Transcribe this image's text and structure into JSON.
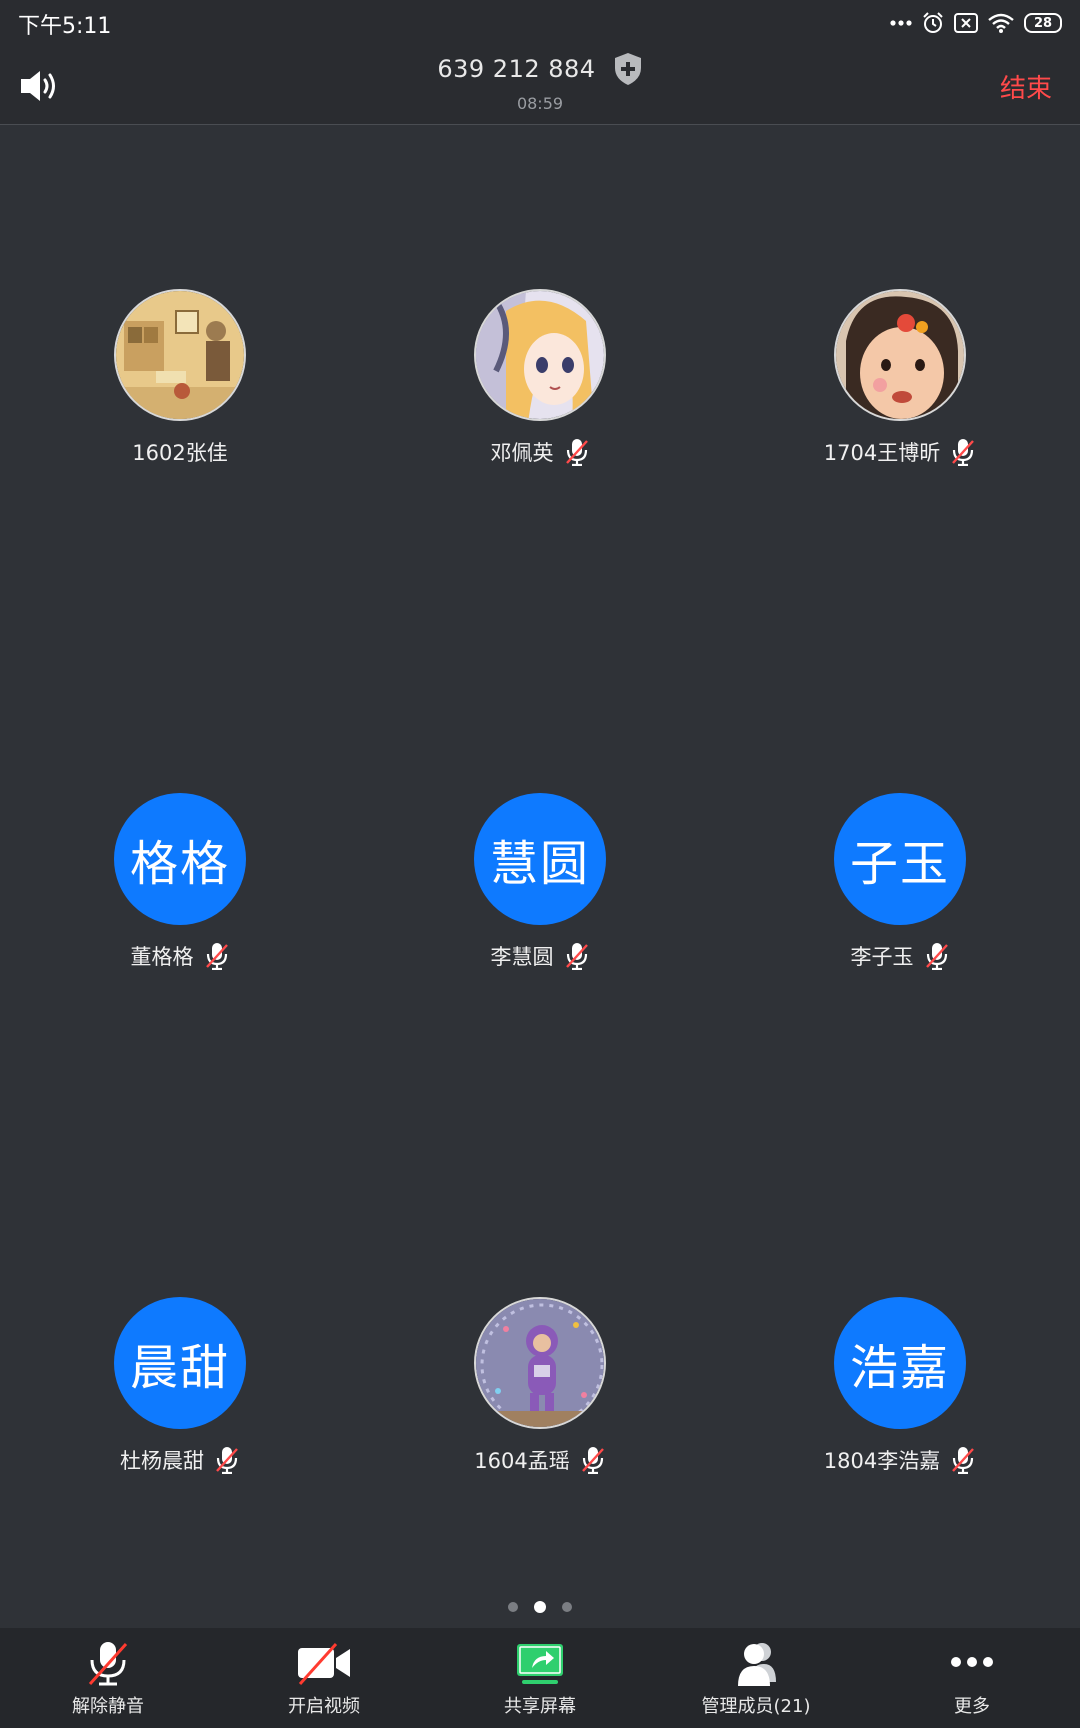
{
  "status_bar": {
    "time": "下午5:11",
    "battery": "28",
    "icons": [
      "more-dots-icon",
      "alarm-icon",
      "notification-x-icon",
      "wifi-icon",
      "battery-icon"
    ]
  },
  "header": {
    "meeting_id": "639 212 884",
    "duration": "08:59",
    "end_label": "结束",
    "end_color": "#ff4a4a",
    "speaker_icon": "speaker-icon",
    "shield_icon": "shield-icon"
  },
  "participants": [
    {
      "name": "1602张佳",
      "avatar_type": "photo",
      "avatar_text": "",
      "muted": false
    },
    {
      "name": "邓佩英",
      "avatar_type": "photo",
      "avatar_text": "",
      "muted": true
    },
    {
      "name": "1704王博昕",
      "avatar_type": "photo",
      "avatar_text": "",
      "muted": true
    },
    {
      "name": "董格格",
      "avatar_type": "text",
      "avatar_text": "格格",
      "muted": true
    },
    {
      "name": "李慧圆",
      "avatar_type": "text",
      "avatar_text": "慧圆",
      "muted": true
    },
    {
      "name": "李子玉",
      "avatar_type": "text",
      "avatar_text": "子玉",
      "muted": true
    },
    {
      "name": "杜杨晨甜",
      "avatar_type": "text",
      "avatar_text": "晨甜",
      "muted": true
    },
    {
      "name": "1604孟瑶",
      "avatar_type": "photo",
      "avatar_text": "",
      "muted": true
    },
    {
      "name": "1804李浩嘉",
      "avatar_type": "text",
      "avatar_text": "浩嘉",
      "muted": true
    }
  ],
  "avatar_color": "#0e7aff",
  "pagination": {
    "pages": 3,
    "current": 2
  },
  "toolbar": {
    "unmute_label": "解除静音",
    "video_label": "开启视频",
    "share_label": "共享屏幕",
    "members_label": "管理成员(21)",
    "more_label": "更多",
    "share_color": "#2fcf6e"
  }
}
